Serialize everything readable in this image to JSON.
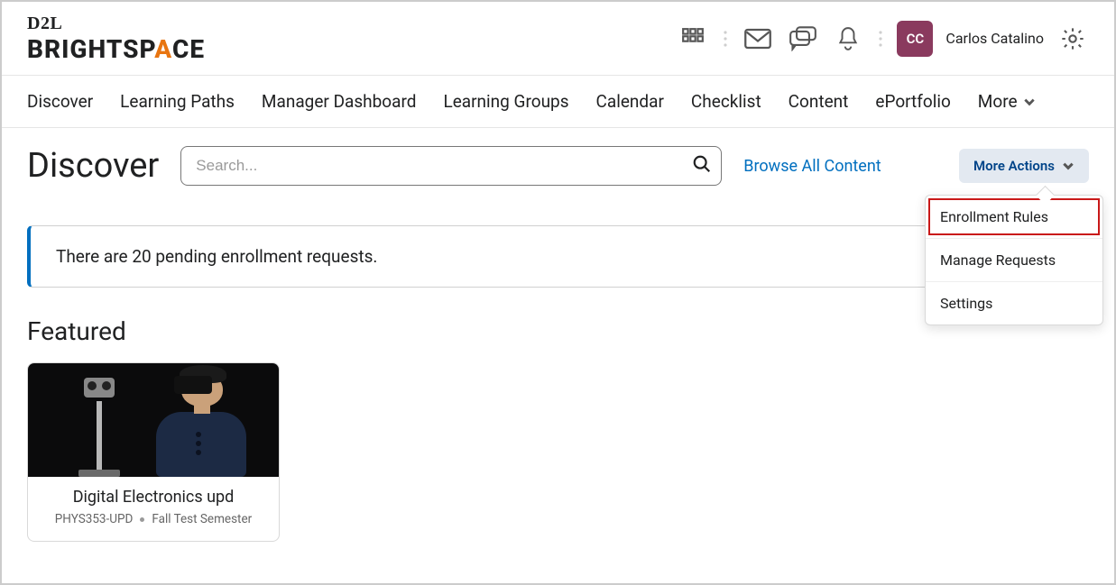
{
  "brand": {
    "top": "D2L",
    "name_before": "BRIGHTSP",
    "flame": "A",
    "name_after": "CE"
  },
  "user": {
    "initials": "CC",
    "name": "Carlos Catalino"
  },
  "nav": {
    "items": [
      "Discover",
      "Learning Paths",
      "Manager Dashboard",
      "Learning Groups",
      "Calendar",
      "Checklist",
      "Content",
      "ePortfolio"
    ],
    "more_label": "More"
  },
  "page": {
    "title": "Discover",
    "search_placeholder": "Search...",
    "browse_all": "Browse All Content",
    "more_actions_label": "More Actions"
  },
  "more_actions_menu": {
    "items": [
      "Enrollment Rules",
      "Manage Requests",
      "Settings"
    ],
    "highlighted_index": 0
  },
  "alert": {
    "text": "There are 20 pending enrollment requests."
  },
  "featured": {
    "heading": "Featured",
    "card": {
      "title": "Digital Electronics upd",
      "code": "PHYS353-UPD",
      "term": "Fall Test Semester"
    }
  }
}
